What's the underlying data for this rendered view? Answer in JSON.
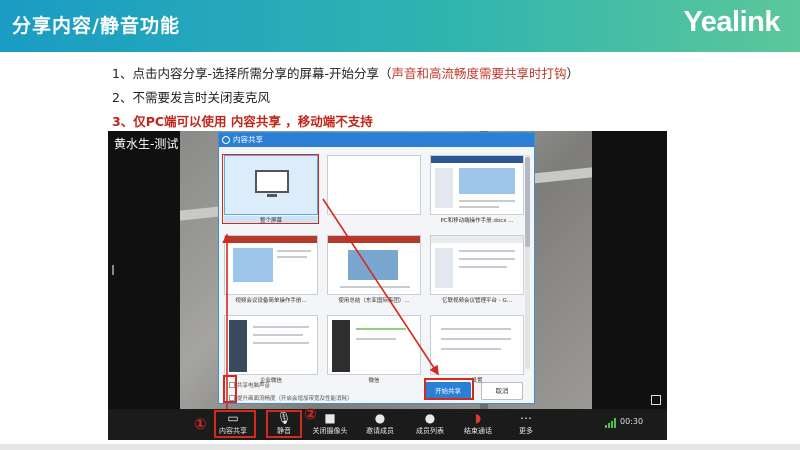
{
  "header": {
    "title": "分享内容/静音功能",
    "brand": "Yealink"
  },
  "colors": {
    "header_gradient": [
      "#1a9cc4",
      "#5cc79a"
    ],
    "accent_red": "#c0271b",
    "dialog_blue": "#2b7fd4"
  },
  "steps": {
    "s1_prefix": "1、点击内容分享-选择所需分享的屏幕-开始分享（",
    "s1_red": "声音和高流畅度需要共享时打钩",
    "s1_suffix": "）",
    "s2": "2、不需要发言时关闭麦克风",
    "s3_prefix": "3、",
    "s3_red": "仅PC端可以使用 内容共享 ，移动端不支持"
  },
  "meeting": {
    "participant_name": "黄水生-测试",
    "timer": "00:30"
  },
  "dialog": {
    "title": "内容共享",
    "tiles": [
      {
        "caption": "整个屏幕",
        "selected": true
      },
      {
        "caption": "",
        "selected": false
      },
      {
        "caption": "PC和移动端操作手册.docx ...",
        "selected": false
      },
      {
        "caption": "视频会议设备简单操作手册...",
        "selected": false
      },
      {
        "caption": "使用总结（东亚国际集团）...",
        "selected": false
      },
      {
        "caption": "亿联视频会议管理平台 - G...",
        "selected": false
      },
      {
        "caption": "企业微信",
        "selected": false
      },
      {
        "caption": "微信",
        "selected": false
      },
      {
        "caption": "设置",
        "selected": false
      }
    ],
    "option_sound": "共享电脑声音",
    "option_fluency": "提升画面流畅度（开启会增加带宽及性能消耗）",
    "start_button": "开始共享",
    "cancel_button": "取消"
  },
  "toolbar": {
    "buttons": [
      {
        "label": "内容共享",
        "icon": "monitor-icon"
      },
      {
        "label": "静音",
        "icon": "mic-muted-icon"
      },
      {
        "label": "关闭摄像头",
        "icon": "camera-icon"
      },
      {
        "label": "邀请成员",
        "icon": "add-user-icon"
      },
      {
        "label": "成员列表",
        "icon": "members-icon"
      },
      {
        "label": "结束通话",
        "icon": "hangup-icon"
      },
      {
        "label": "更多",
        "icon": "more-icon"
      }
    ]
  },
  "callouts": {
    "one": "①",
    "two": "②"
  }
}
